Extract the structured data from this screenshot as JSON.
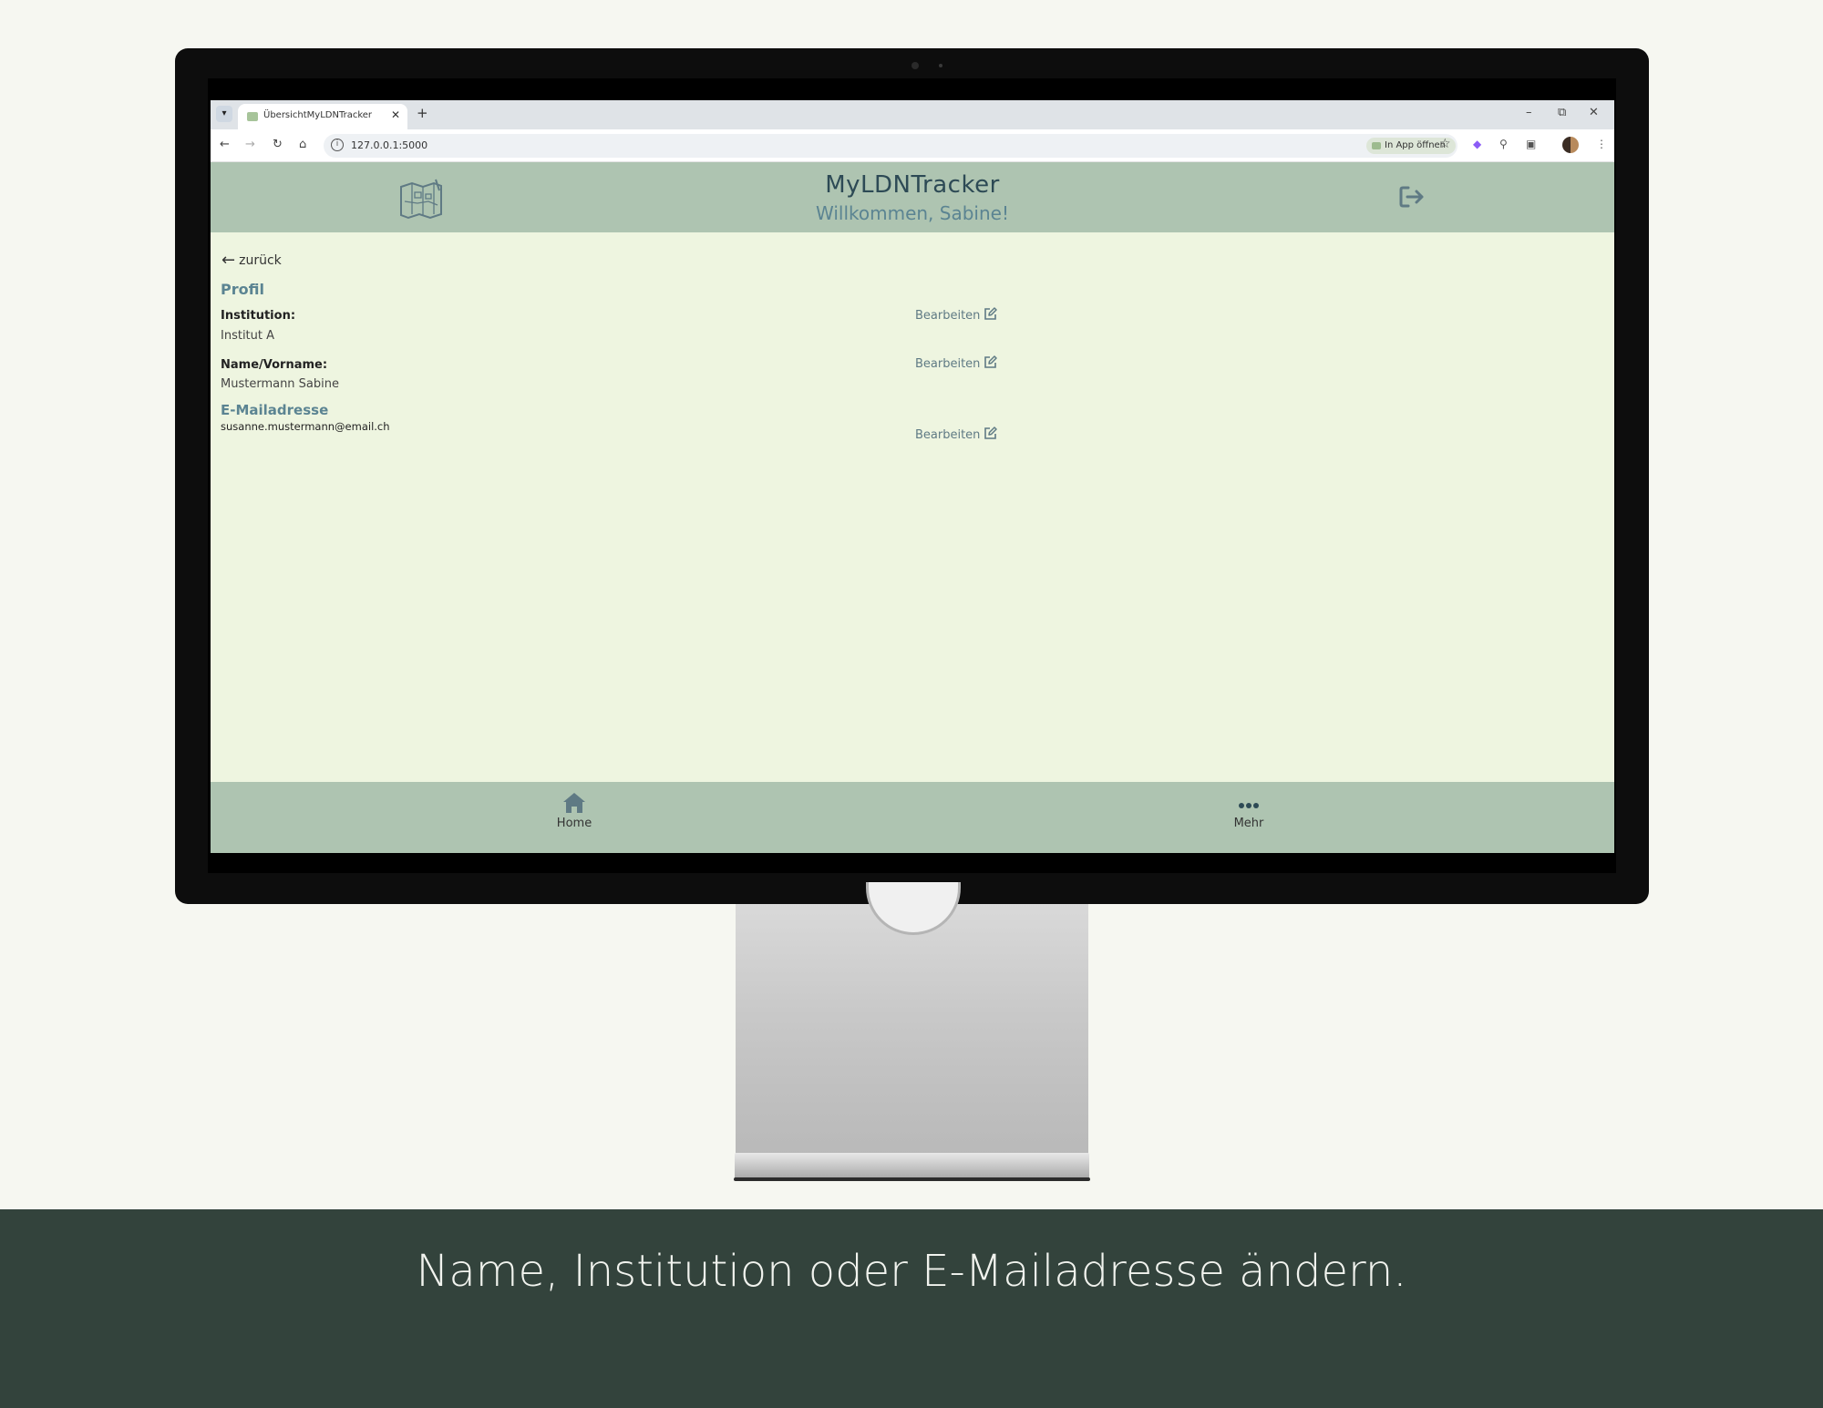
{
  "browser": {
    "tab_title": "ÜbersichtMyLDNTracker",
    "tab_close": "✕",
    "tab_new": "+",
    "url": "127.0.0.1:5000",
    "open_in_app": "In App öffnen",
    "window_minimize": "–",
    "window_restore": "⧉",
    "window_close": "✕"
  },
  "header": {
    "title": "MyLDNTracker",
    "subtitle": "Willkommen, Sabine!"
  },
  "profile": {
    "back_label": "zurück",
    "section_title": "Profil",
    "institution_label": "Institution:",
    "institution_value": "Institut A",
    "name_label": "Name/Vorname:",
    "name_value": "Mustermann Sabine",
    "email_title": "E-Mailadresse",
    "email_value": "susanne.mustermann@email.ch",
    "edit_label": "Bearbeiten"
  },
  "footer": {
    "home_label": "Home",
    "more_label": "Mehr"
  },
  "caption": "Name, Institution oder E-Mailadresse ändern.",
  "colors": {
    "header_bg": "#aec4b1",
    "content_bg": "#eef5e0",
    "accent": "#5b8492",
    "caption_bg": "#33433c"
  }
}
